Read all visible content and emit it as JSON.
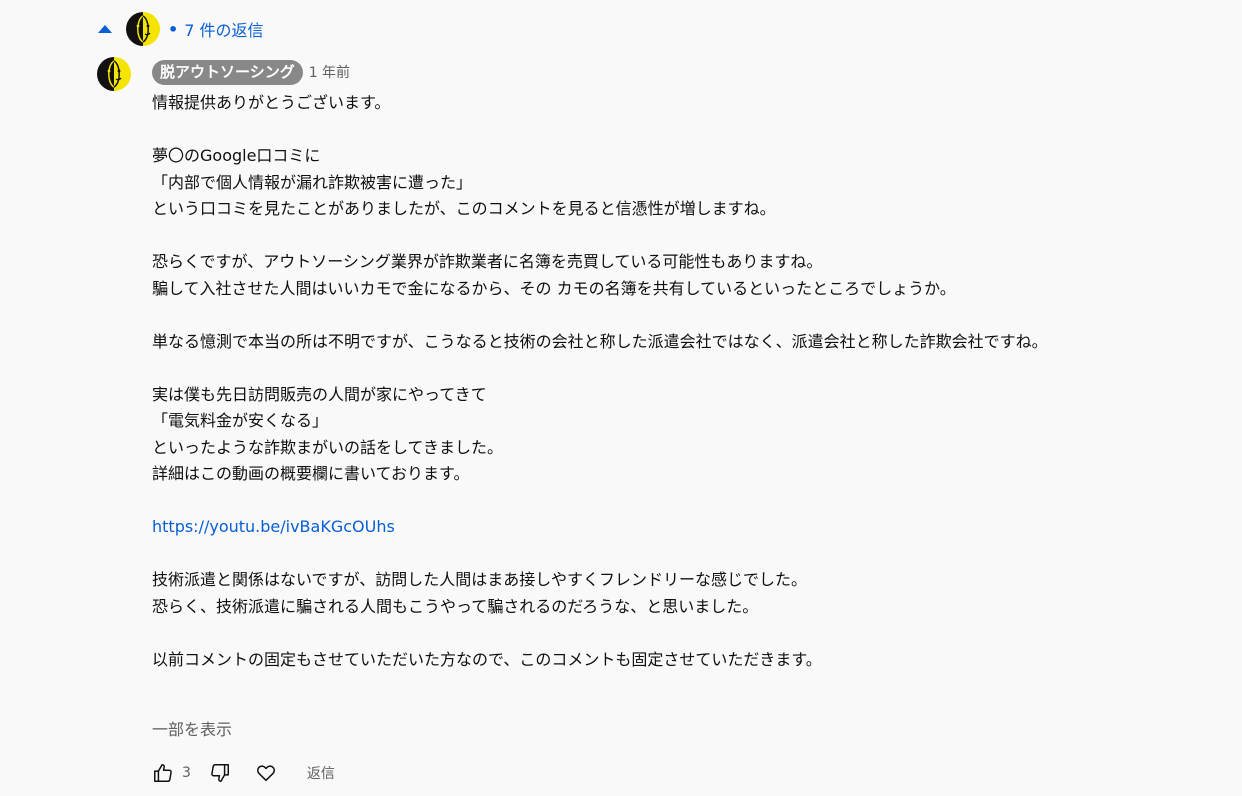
{
  "replies_toggle": {
    "caret_icon": "caret-up-icon",
    "dot": "•",
    "label": "7 件の返信"
  },
  "comment": {
    "author": "脱アウトソーシング",
    "timestamp": "1 年前",
    "paragraphs": [
      [
        "情報提供ありがとうございます。"
      ],
      [
        "夢〇のGoogle口コミに",
        "「内部で個人情報が漏れ詐欺被害に遭った」",
        "という口コミを見たことがありましたが、このコメントを見ると信憑性が増しますね。"
      ],
      [
        "恐らくですが、アウトソーシング業界が詐欺業者に名簿を売買している可能性もありますね。",
        "騙して入社させた人間はいいカモで金になるから、その カモの名簿を共有しているといったところでしょうか。"
      ],
      [
        "単なる憶測で本当の所は不明ですが、こうなると技術の会社と称した派遣会社ではなく、派遣会社と称した詐欺会社ですね。"
      ],
      [
        "実は僕も先日訪問販売の人間が家にやってきて",
        "「電気料金が安くなる」",
        "といったような詐欺まがいの話をしてきました。",
        "詳細はこの動画の概要欄に書いております。"
      ]
    ],
    "link": "https://youtu.be/ivBaKGcOUhs",
    "paragraphs_after_link": [
      [
        "技術派遣と関係はないですが、訪問した人間はまあ接しやすくフレンドリーな感じでした。",
        "恐らく、技術派遣に騙される人間もこうやって騙されるのだろうな、と思いました。"
      ],
      [
        "以前コメントの固定もさせていただいた方なので、このコメントも固定させていただきます。"
      ]
    ],
    "show_more": "一部を表示",
    "like_count": "3",
    "reply_label": "返信"
  },
  "colors": {
    "link": "#065fd4",
    "author_chip_bg": "#888888",
    "background": "#f9f9f9",
    "secondary_text": "#606060"
  }
}
